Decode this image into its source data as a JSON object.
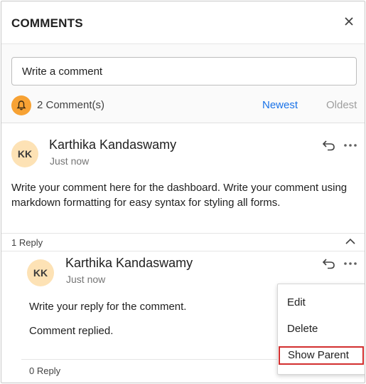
{
  "header": {
    "title": "COMMENTS"
  },
  "compose": {
    "placeholder": "Write a comment"
  },
  "summary": {
    "count_label": "2 Comment(s)",
    "sort_newest": "Newest",
    "sort_oldest": "Oldest"
  },
  "comment": {
    "initials": "KK",
    "author": "Karthika Kandaswamy",
    "time": "Just now",
    "text_line1": "Write your comment here for the dashboard. Write your comment using",
    "text_line2": "markdown formatting for easy syntax for styling all forms."
  },
  "replies_bar": {
    "label": "1 Reply"
  },
  "reply": {
    "initials": "KK",
    "author": "Karthika Kandaswamy",
    "time": "Just now",
    "text_line1": "Write your reply for the comment.",
    "text_line2": "Comment replied.",
    "footer_label": "0 Reply"
  },
  "context_menu": {
    "items": [
      "Edit",
      "Delete",
      "Show Parent"
    ]
  },
  "colors": {
    "accent": "#1a73e8",
    "bell": "#f7a234",
    "avatar": "#fde2b5",
    "highlight": "#d32f2f"
  }
}
